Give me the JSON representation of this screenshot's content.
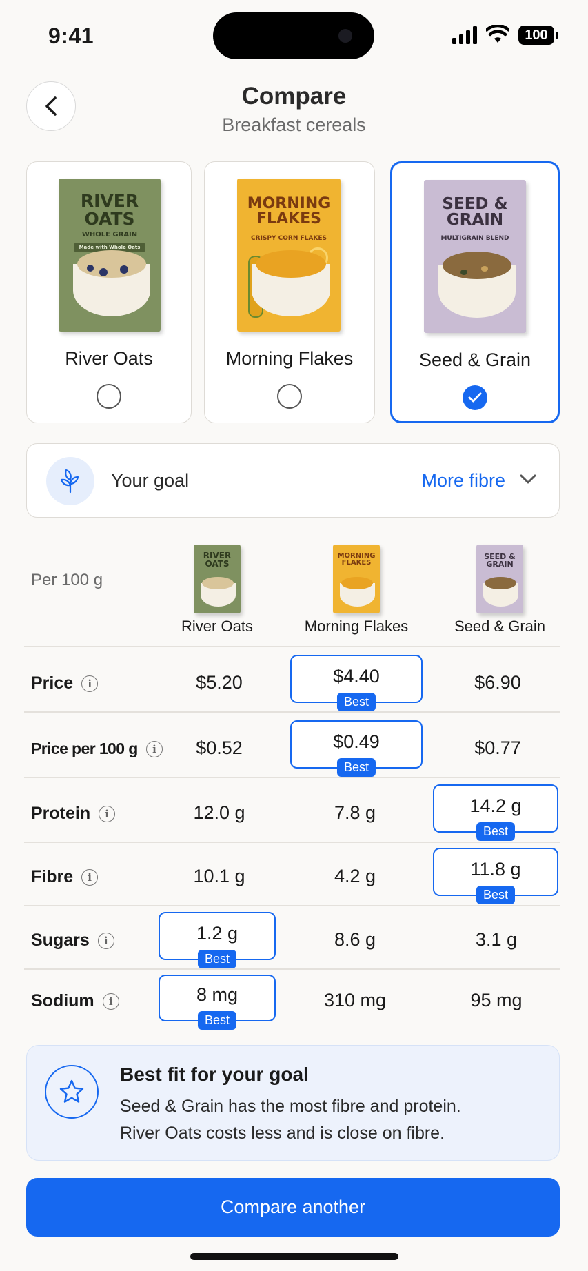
{
  "status": {
    "time": "9:41",
    "battery": "100"
  },
  "header": {
    "title": "Compare",
    "subtitle": "Breakfast cereals"
  },
  "products": [
    {
      "name": "River Oats",
      "box_title": "RIVER OATS",
      "box_sub": "WHOLE GRAIN",
      "box_tag": "Made with Whole Oats",
      "selected": false,
      "box_color": "#7F9160",
      "title_color": "#2E3A1E"
    },
    {
      "name": "Morning Flakes",
      "box_title": "MORNING FLAKES",
      "box_sub": "CRISPY CORN FLAKES",
      "box_tag": "",
      "selected": false,
      "box_color": "#F0B431",
      "title_color": "#7A3A10"
    },
    {
      "name": "Seed & Grain",
      "box_title": "SEED & GRAIN",
      "box_sub": "MULTIGRAIN BLEND",
      "box_tag": "",
      "selected": true,
      "box_color": "#C9BCD3",
      "title_color": "#3B3140"
    }
  ],
  "goal": {
    "label": "Your goal",
    "value": "More fibre"
  },
  "table": {
    "per_label": "Per 100 g",
    "columns": [
      "River Oats",
      "Morning Flakes",
      "Seed & Grain"
    ],
    "best_tag": "Best",
    "rows": [
      {
        "label": "Price",
        "values": [
          "$5.20",
          "$4.40",
          "$6.90"
        ],
        "best": 1
      },
      {
        "label": "Price per 100 g",
        "values": [
          "$0.52",
          "$0.49",
          "$0.77"
        ],
        "best": 1
      },
      {
        "label": "Protein",
        "values": [
          "12.0 g",
          "7.8 g",
          "14.2 g"
        ],
        "best": 2
      },
      {
        "label": "Fibre",
        "values": [
          "10.1 g",
          "4.2 g",
          "11.8 g"
        ],
        "best": 2
      },
      {
        "label": "Sugars",
        "values": [
          "1.2 g",
          "8.6 g",
          "3.1 g"
        ],
        "best": 0
      },
      {
        "label": "Sodium",
        "values": [
          "8 mg",
          "310 mg",
          "95 mg"
        ],
        "best": 0
      }
    ]
  },
  "best_fit": {
    "title": "Best fit for your goal",
    "line1": "Seed & Grain has the most fibre and protein.",
    "line2": "River Oats costs less and is close on fibre."
  },
  "cta": {
    "label": "Compare another"
  },
  "colors": {
    "accent": "#1668F0",
    "background": "#FAF9F7"
  }
}
